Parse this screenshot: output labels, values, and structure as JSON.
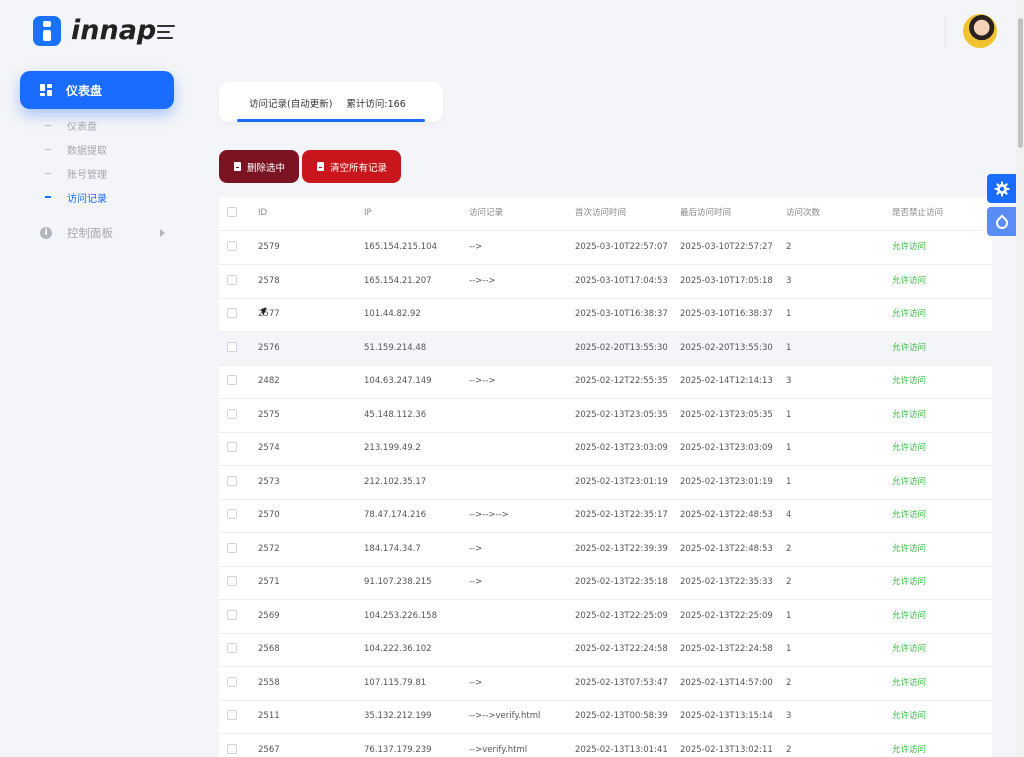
{
  "header": {
    "logo_text": "innap"
  },
  "sidebar": {
    "active_label": "仪表盘",
    "sub_items": [
      "仪表盘",
      "数据提取",
      "账号管理",
      "访问记录"
    ],
    "control_panel": "控制面板"
  },
  "tab": {
    "label": "访问记录(自动更新)",
    "count_label": "累计访问:",
    "count": "166"
  },
  "buttons": {
    "delete_selected": "删除选中",
    "clear_all": "清空所有记录"
  },
  "table": {
    "columns": [
      "ID",
      "IP",
      "访问记录",
      "首次访问时间",
      "最后访问时间",
      "访问次数",
      "是否禁止访问"
    ],
    "rows": [
      {
        "id": "2579",
        "ip": "165.154.215.104",
        "record": "-->",
        "first": "2025-03-10T22:57:07",
        "last": "2025-03-10T22:57:27",
        "count": "2",
        "status": "允许访问"
      },
      {
        "id": "2578",
        "ip": "165.154.21.207",
        "record": "-->-->",
        "first": "2025-03-10T17:04:53",
        "last": "2025-03-10T17:05:18",
        "count": "3",
        "status": "允许访问"
      },
      {
        "id": "2577",
        "ip": "101.44.82.92",
        "record": "",
        "first": "2025-03-10T16:38:37",
        "last": "2025-03-10T16:38:37",
        "count": "1",
        "status": "允许访问"
      },
      {
        "id": "2576",
        "ip": "51.159.214.48",
        "record": "",
        "first": "2025-02-20T13:55:30",
        "last": "2025-02-20T13:55:30",
        "count": "1",
        "status": "允许访问"
      },
      {
        "id": "2482",
        "ip": "104.63.247.149",
        "record": "-->-->",
        "first": "2025-02-12T22:55:35",
        "last": "2025-02-14T12:14:13",
        "count": "3",
        "status": "允许访问"
      },
      {
        "id": "2575",
        "ip": "45.148.112.36",
        "record": "",
        "first": "2025-02-13T23:05:35",
        "last": "2025-02-13T23:05:35",
        "count": "1",
        "status": "允许访问"
      },
      {
        "id": "2574",
        "ip": "213.199.49.2",
        "record": "",
        "first": "2025-02-13T23:03:09",
        "last": "2025-02-13T23:03:09",
        "count": "1",
        "status": "允许访问"
      },
      {
        "id": "2573",
        "ip": "212.102.35.17",
        "record": "",
        "first": "2025-02-13T23:01:19",
        "last": "2025-02-13T23:01:19",
        "count": "1",
        "status": "允许访问"
      },
      {
        "id": "2570",
        "ip": "78.47.174.216",
        "record": "-->-->-->",
        "first": "2025-02-13T22:35:17",
        "last": "2025-02-13T22:48:53",
        "count": "4",
        "status": "允许访问"
      },
      {
        "id": "2572",
        "ip": "184.174.34.7",
        "record": "-->",
        "first": "2025-02-13T22:39:39",
        "last": "2025-02-13T22:48:53",
        "count": "2",
        "status": "允许访问"
      },
      {
        "id": "2571",
        "ip": "91.107.238.215",
        "record": "-->",
        "first": "2025-02-13T22:35:18",
        "last": "2025-02-13T22:35:33",
        "count": "2",
        "status": "允许访问"
      },
      {
        "id": "2569",
        "ip": "104.253.226.158",
        "record": "",
        "first": "2025-02-13T22:25:09",
        "last": "2025-02-13T22:25:09",
        "count": "1",
        "status": "允许访问"
      },
      {
        "id": "2568",
        "ip": "104.222.36.102",
        "record": "",
        "first": "2025-02-13T22:24:58",
        "last": "2025-02-13T22:24:58",
        "count": "1",
        "status": "允许访问"
      },
      {
        "id": "2558",
        "ip": "107.115.79.81",
        "record": "-->",
        "first": "2025-02-13T07:53:47",
        "last": "2025-02-13T14:57:00",
        "count": "2",
        "status": "允许访问"
      },
      {
        "id": "2511",
        "ip": "35.132.212.199",
        "record": "-->-->verify.html",
        "first": "2025-02-13T00:58:39",
        "last": "2025-02-13T13:15:14",
        "count": "3",
        "status": "允许访问"
      },
      {
        "id": "2567",
        "ip": "76.137.179.239",
        "record": "-->verify.html",
        "first": "2025-02-13T13:01:41",
        "last": "2025-02-13T13:02:11",
        "count": "2",
        "status": "允许访问"
      }
    ]
  },
  "colors": {
    "primary": "#1a6bff",
    "delete": "#7b1422",
    "clear": "#c8161c",
    "allow": "#2fbf3a"
  },
  "icons": [
    "grid-icon",
    "info-icon",
    "gear-icon",
    "drop-icon",
    "document-icon",
    "menu-icon"
  ]
}
